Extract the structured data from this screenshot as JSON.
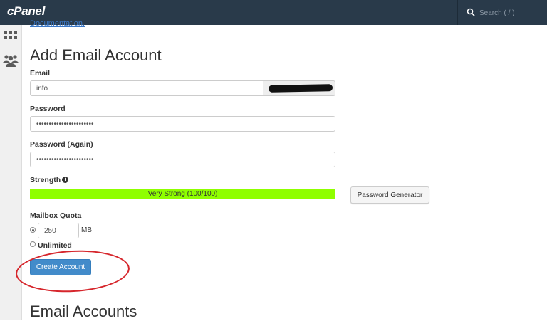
{
  "header": {
    "logo": "cPanel",
    "search_placeholder": "Search ( / )"
  },
  "sidebar": {
    "items": [
      {
        "icon": "grid-icon"
      },
      {
        "icon": "users-icon"
      }
    ]
  },
  "main": {
    "docs_link": "Documentation.",
    "title": "Add Email Account",
    "email": {
      "label": "Email",
      "value": "info"
    },
    "password": {
      "label": "Password",
      "value": "•••••••••••••••••••••••"
    },
    "password_again": {
      "label": "Password (Again)",
      "value": "•••••••••••••••••••••••"
    },
    "strength": {
      "label": "Strength",
      "text": "Very Strong (100/100)",
      "percent": 100,
      "color": "#8fff00"
    },
    "password_generator_label": "Password Generator",
    "quota": {
      "label": "Mailbox Quota",
      "value": "250",
      "unit": "MB",
      "unlimited_label": "Unlimited"
    },
    "create_label": "Create Account",
    "accounts_title": "Email Accounts"
  },
  "colors": {
    "header_bg": "#293a4a",
    "primary": "#428bca",
    "annotation": "#d6262c"
  }
}
